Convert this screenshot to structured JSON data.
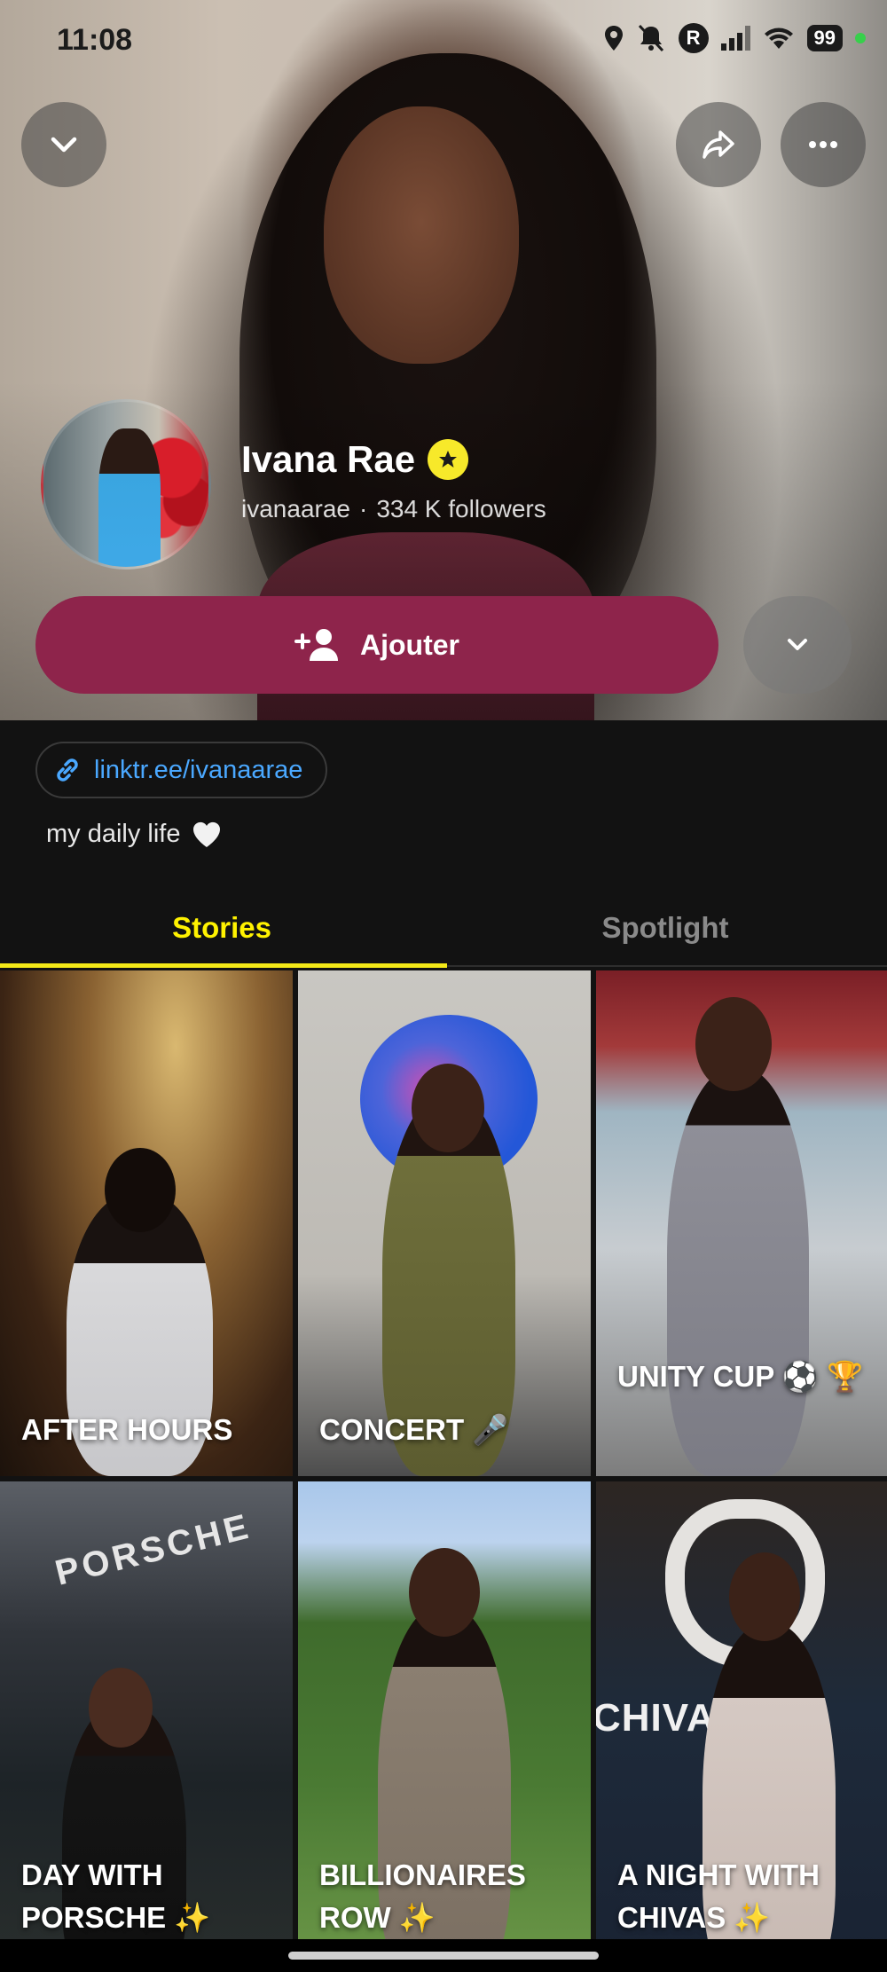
{
  "status_bar": {
    "time": "11:08",
    "battery": "99",
    "r_badge": "R"
  },
  "profile": {
    "name": "Ivana Rae",
    "username": "ivanaarae",
    "separator": "·",
    "followers": "334 K followers",
    "add_label": "Ajouter",
    "link": "linktr.ee/ivanaarae",
    "bio": "my daily life"
  },
  "tabs": [
    {
      "label": "Stories",
      "active": true
    },
    {
      "label": "Spotlight",
      "active": false
    }
  ],
  "stories": [
    {
      "title": "AFTER HOURS",
      "emoji": ""
    },
    {
      "title": "CONCERT",
      "emoji": "🎤"
    },
    {
      "title": "UNITY CUP",
      "emoji": "⚽ 🏆"
    },
    {
      "title": "DAY WITH PORSCHE",
      "emoji": "✨"
    },
    {
      "title": "BILLIONAIRES ROW",
      "emoji": "✨"
    },
    {
      "title": "A NIGHT WITH CHIVAS",
      "emoji": "✨"
    }
  ],
  "tile_text": {
    "porsche_sign": "PORSCHE",
    "chivas_sign": "CHIVAS"
  },
  "colors": {
    "add_button": "#8e244b",
    "active_tab": "#f3e818",
    "link": "#4aa8ff",
    "verified_badge": "#f7e92a"
  },
  "icons": {
    "back": "chevron-down-icon",
    "share": "share-arrow-icon",
    "more": "more-dots-icon",
    "verified": "star-badge-icon",
    "add": "add-friend-icon",
    "expand": "chevron-down-icon",
    "link": "link-icon",
    "bio": "white-heart-icon"
  }
}
